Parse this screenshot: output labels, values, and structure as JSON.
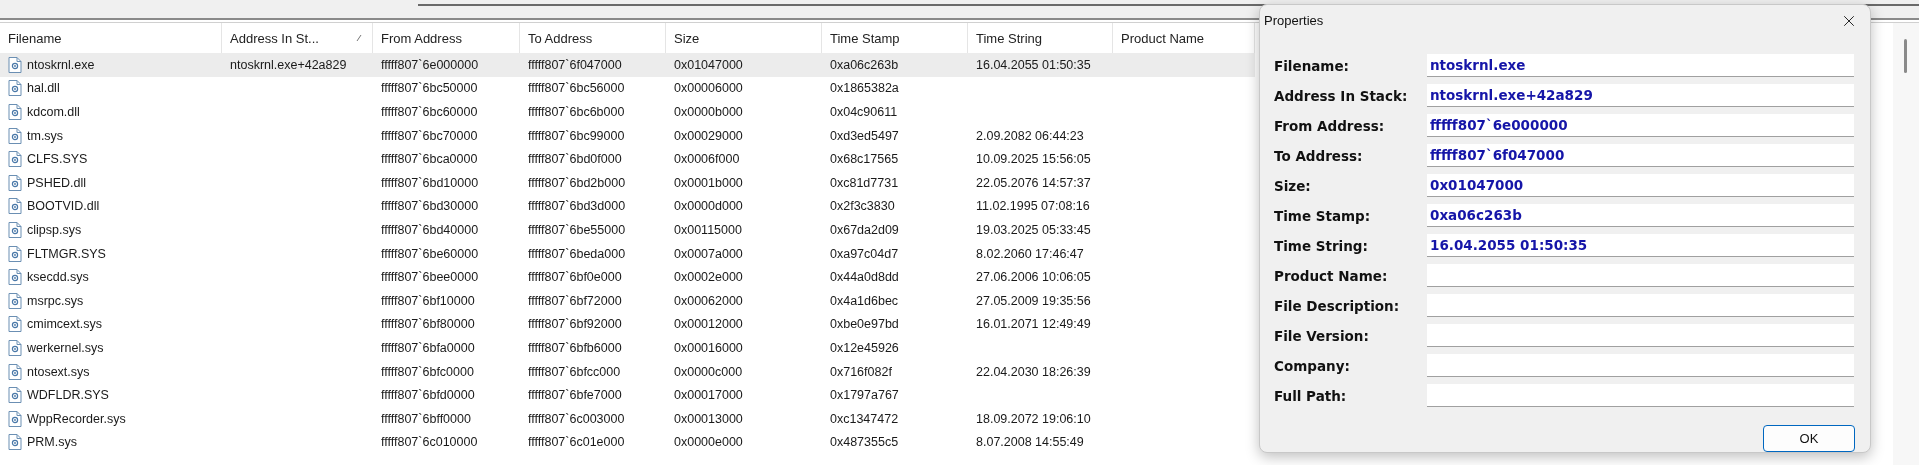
{
  "columns": [
    {
      "label": "Filename",
      "sorted": false
    },
    {
      "label": "Address In St...",
      "sorted": true
    },
    {
      "label": "From Address",
      "sorted": false
    },
    {
      "label": "To Address",
      "sorted": false
    },
    {
      "label": "Size",
      "sorted": false
    },
    {
      "label": "Time Stamp",
      "sorted": false
    },
    {
      "label": "Time String",
      "sorted": false
    },
    {
      "label": "Product Name",
      "sorted": false
    }
  ],
  "rows": [
    {
      "selected": true,
      "cells": [
        "ntoskrnl.exe",
        "ntoskrnl.exe+42a829",
        "fffff807`6e000000",
        "fffff807`6f047000",
        "0x01047000",
        "0xa06c263b",
        "16.04.2055 01:50:35"
      ]
    },
    {
      "selected": false,
      "cells": [
        "hal.dll",
        null,
        "fffff807`6bc50000",
        "fffff807`6bc56000",
        "0x00006000",
        "0x1865382a",
        null
      ]
    },
    {
      "selected": false,
      "cells": [
        "kdcom.dll",
        null,
        "fffff807`6bc60000",
        "fffff807`6bc6b000",
        "0x0000b000",
        "0x04c90611",
        null
      ]
    },
    {
      "selected": false,
      "cells": [
        "tm.sys",
        null,
        "fffff807`6bc70000",
        "fffff807`6bc99000",
        "0x00029000",
        "0xd3ed5497",
        "2.09.2082 06:44:23"
      ]
    },
    {
      "selected": false,
      "cells": [
        "CLFS.SYS",
        null,
        "fffff807`6bca0000",
        "fffff807`6bd0f000",
        "0x0006f000",
        "0x68c17565",
        "10.09.2025 15:56:05"
      ]
    },
    {
      "selected": false,
      "cells": [
        "PSHED.dll",
        null,
        "fffff807`6bd10000",
        "fffff807`6bd2b000",
        "0x0001b000",
        "0xc81d7731",
        "22.05.2076 14:57:37"
      ]
    },
    {
      "selected": false,
      "cells": [
        "BOOTVID.dll",
        null,
        "fffff807`6bd30000",
        "fffff807`6bd3d000",
        "0x0000d000",
        "0x2f3c3830",
        "11.02.1995 07:08:16"
      ]
    },
    {
      "selected": false,
      "cells": [
        "clipsp.sys",
        null,
        "fffff807`6bd40000",
        "fffff807`6be55000",
        "0x00115000",
        "0x67da2d09",
        "19.03.2025 05:33:45"
      ]
    },
    {
      "selected": false,
      "cells": [
        "FLTMGR.SYS",
        null,
        "fffff807`6be60000",
        "fffff807`6beda000",
        "0x0007a000",
        "0xa97c04d7",
        "8.02.2060 17:46:47"
      ]
    },
    {
      "selected": false,
      "cells": [
        "ksecdd.sys",
        null,
        "fffff807`6bee0000",
        "fffff807`6bf0e000",
        "0x0002e000",
        "0x44a0d8dd",
        "27.06.2006 10:06:05"
      ]
    },
    {
      "selected": false,
      "cells": [
        "msrpc.sys",
        null,
        "fffff807`6bf10000",
        "fffff807`6bf72000",
        "0x00062000",
        "0x4a1d6bec",
        "27.05.2009 19:35:56"
      ]
    },
    {
      "selected": false,
      "cells": [
        "cmimcext.sys",
        null,
        "fffff807`6bf80000",
        "fffff807`6bf92000",
        "0x00012000",
        "0xbe0e97bd",
        "16.01.2071 12:49:49"
      ]
    },
    {
      "selected": false,
      "cells": [
        "werkernel.sys",
        null,
        "fffff807`6bfa0000",
        "fffff807`6bfb6000",
        "0x00016000",
        "0x12e45926",
        null
      ]
    },
    {
      "selected": false,
      "cells": [
        "ntosext.sys",
        null,
        "fffff807`6bfc0000",
        "fffff807`6bfcc000",
        "0x0000c000",
        "0x716f082f",
        "22.04.2030 18:26:39"
      ]
    },
    {
      "selected": false,
      "cells": [
        "WDFLDR.SYS",
        null,
        "fffff807`6bfd0000",
        "fffff807`6bfe7000",
        "0x00017000",
        "0x1797a767",
        null
      ]
    },
    {
      "selected": false,
      "cells": [
        "WppRecorder.sys",
        null,
        "fffff807`6bff0000",
        "fffff807`6c003000",
        "0x00013000",
        "0xc1347472",
        "18.09.2072 19:06:10"
      ]
    },
    {
      "selected": false,
      "cells": [
        "PRM.sys",
        null,
        "fffff807`6c010000",
        "fffff807`6c01e000",
        "0x0000e000",
        "0x487355c5",
        "8.07.2008 14:55:49"
      ]
    }
  ],
  "dialog": {
    "title": "Properties",
    "fields": [
      {
        "label": "Filename:",
        "value": "ntoskrnl.exe"
      },
      {
        "label": "Address In Stack:",
        "value": "ntoskrnl.exe+42a829"
      },
      {
        "label": "From Address:",
        "value": "fffff807`6e000000"
      },
      {
        "label": "To Address:",
        "value": "fffff807`6f047000"
      },
      {
        "label": "Size:",
        "value": "0x01047000"
      },
      {
        "label": "Time Stamp:",
        "value": "0xa06c263b"
      },
      {
        "label": "Time String:",
        "value": "16.04.2055 01:50:35"
      },
      {
        "label": "Product Name:"
      },
      {
        "label": "File Description:"
      },
      {
        "label": "File Version:"
      },
      {
        "label": "Company:"
      },
      {
        "label": "Full Path:"
      }
    ],
    "button": "OK"
  }
}
